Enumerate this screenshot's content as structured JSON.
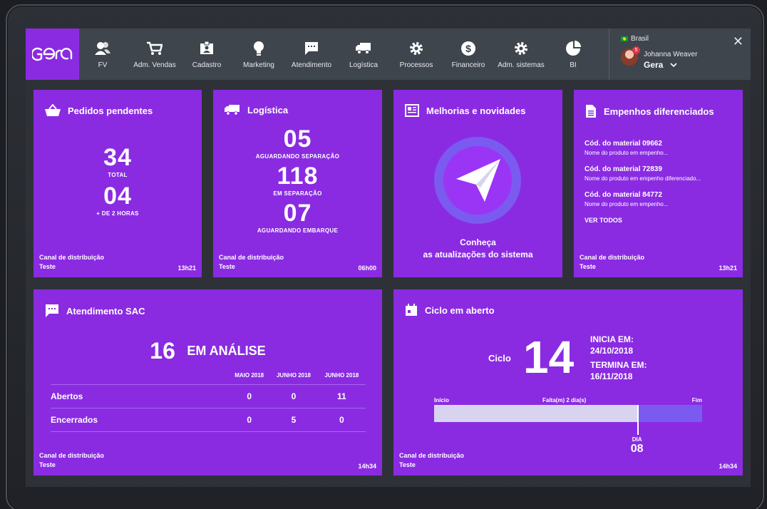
{
  "brand": "Gera",
  "nav": [
    {
      "label": "FV",
      "icon": "users-icon"
    },
    {
      "label": "Adm. Vendas",
      "icon": "cart-icon"
    },
    {
      "label": "Cadastro",
      "icon": "id-card-icon"
    },
    {
      "label": "Marketing",
      "icon": "lightbulb-icon"
    },
    {
      "label": "Atendimento",
      "icon": "chat-icon"
    },
    {
      "label": "Logística",
      "icon": "truck-icon"
    },
    {
      "label": "Processos",
      "icon": "gear-icon"
    },
    {
      "label": "Financeiro",
      "icon": "dollar-icon"
    },
    {
      "label": "Adm. sistemas",
      "icon": "gear-icon"
    },
    {
      "label": "BI",
      "icon": "pie-chart-icon"
    }
  ],
  "user": {
    "country": "Brasil",
    "name": "Johanna Weaver",
    "company": "Gera",
    "notifications": "5"
  },
  "cards": {
    "pedidos": {
      "title": "Pedidos pendentes",
      "total": "34",
      "total_label": "TOTAL",
      "over2h": "04",
      "over2h_label": "+ DE 2 HORAS",
      "foot_label": "Canal de distribuição",
      "foot_value": "Teste",
      "time": "13h21"
    },
    "logistica": {
      "title": "Logística",
      "v1": "05",
      "l1": "AGUARDANDO SEPARAÇÃO",
      "v2": "118",
      "l2": "EM SEPARAÇÃO",
      "v3": "07",
      "l3": "AGUARDANDO EMBARQUE",
      "foot_label": "Canal de distribuição",
      "foot_value": "Teste",
      "time": "06h00"
    },
    "melhorias": {
      "title": "Melhorias e novidades",
      "line1": "Conheça",
      "line2": "as atualizações do sistema"
    },
    "empenhos": {
      "title": "Empenhos diferenciados",
      "items": [
        {
          "code": "Cód. do material 09662",
          "name": "Nome do produto em empenho..."
        },
        {
          "code": "Cód. do material 72839",
          "name": "Nome do produto em empenho diferenciado..."
        },
        {
          "code": "Cód. do material 84772",
          "name": "Nome do produto em empenho..."
        }
      ],
      "see_all": "VER TODOS",
      "foot_label": "Canal de distribuição",
      "foot_value": "Teste",
      "time": "13h21"
    },
    "sac": {
      "title": "Atendimento SAC",
      "count": "16",
      "status": "EM ANÁLISE",
      "columns": [
        "MAIO 2018",
        "JUNHO 2018",
        "JUNHO 2018"
      ],
      "rows": [
        {
          "label": "Abertos",
          "values": [
            "0",
            "0",
            "11"
          ]
        },
        {
          "label": "Encerrados",
          "values": [
            "0",
            "5",
            "0"
          ]
        }
      ],
      "foot_label": "Canal de distribuição",
      "foot_value": "Teste",
      "time": "14h34"
    },
    "ciclo": {
      "title": "Ciclo em aberto",
      "label": "Ciclo",
      "number": "14",
      "start_label": "INICIA EM:",
      "start": "24/10/2018",
      "end_label": "TERMINA EM:",
      "end": "16/11/2018",
      "bar_start": "Início",
      "bar_mid": "Falta(m) 2 dia(s)",
      "bar_end": "Fim",
      "progress": 0.76,
      "day_label": "DIA",
      "day": "08",
      "foot_label": "Canal de distribuição",
      "foot_value": "Teste",
      "time": "14h34"
    }
  }
}
